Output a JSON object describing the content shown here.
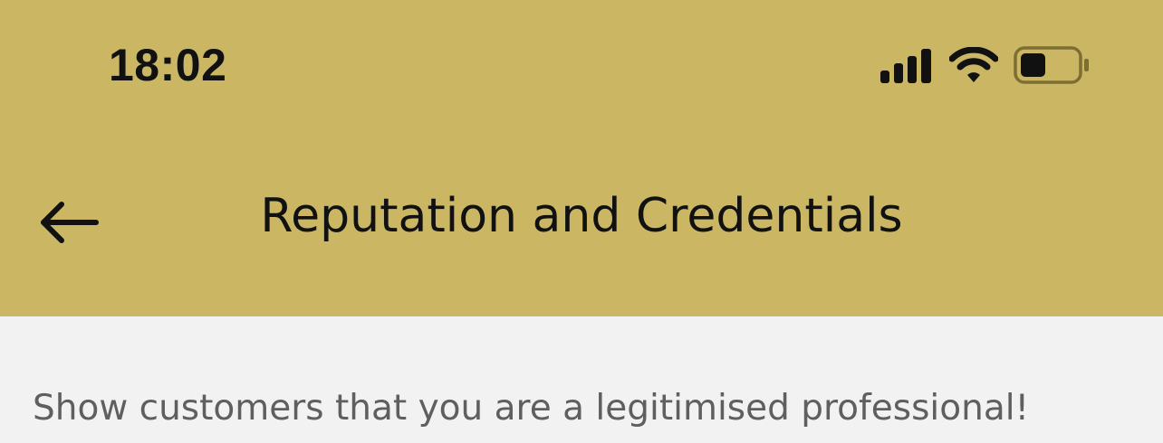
{
  "status_bar": {
    "time": "18:02",
    "icons": [
      "signal-icon",
      "wifi-icon",
      "battery-icon"
    ],
    "battery_level": 0.45
  },
  "header": {
    "back_icon": "arrow-left-icon",
    "title": "Reputation and Credentials",
    "background_color": "#cbb763"
  },
  "content": {
    "subtitle": "Show customers that you are a legitimised professional!",
    "background_color": "#f2f2f2"
  }
}
